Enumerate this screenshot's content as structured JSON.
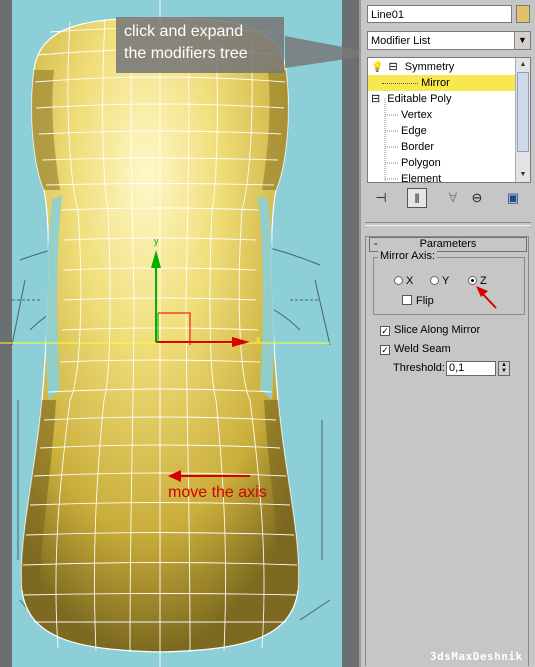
{
  "viewport": {
    "callout_line1": "click and expand",
    "callout_line2": "the modifiers tree",
    "move_label": "move the axis",
    "axis_x_label": "x",
    "axis_y_label": "y"
  },
  "watermark": "3dsMaxDeshnik",
  "panel": {
    "object_name": "Line01",
    "object_color": "#e2c16b",
    "modifier_list_label": "Modifier List",
    "stack": [
      {
        "label": "Symmetry",
        "expand": "⊟"
      },
      {
        "label": "Mirror",
        "selected": true
      },
      {
        "label": "Editable Poly",
        "expand": "⊟"
      },
      {
        "label": "Vertex"
      },
      {
        "label": "Edge"
      },
      {
        "label": "Border"
      },
      {
        "label": "Polygon"
      },
      {
        "label": "Element"
      }
    ],
    "toolbar_icons": [
      "pin-stack-icon",
      "show-end-result-icon",
      "make-unique-icon",
      "remove-modifier-icon",
      "configure-modifier-sets-icon"
    ],
    "rollout_title": "Parameters",
    "rollout_toggle": "-",
    "mirror_axis_label": "Mirror Axis:",
    "axes": [
      {
        "label": "X",
        "checked": false
      },
      {
        "label": "Y",
        "checked": false
      },
      {
        "label": "Z",
        "checked": true
      }
    ],
    "flip": {
      "label": "Flip",
      "checked": false
    },
    "slice": {
      "label": "Slice Along Mirror",
      "checked": true
    },
    "weld": {
      "label": "Weld Seam",
      "checked": true
    },
    "threshold_label": "Threshold:",
    "threshold_value": "0,1"
  },
  "colors": {
    "viewport_bg": "#5a5e62",
    "blueprint": "#8ccfd6",
    "mesh": "#e8d56a",
    "wire": "#ffffff",
    "highlight": "#f6e84e",
    "annotation_red": "#d40000"
  }
}
